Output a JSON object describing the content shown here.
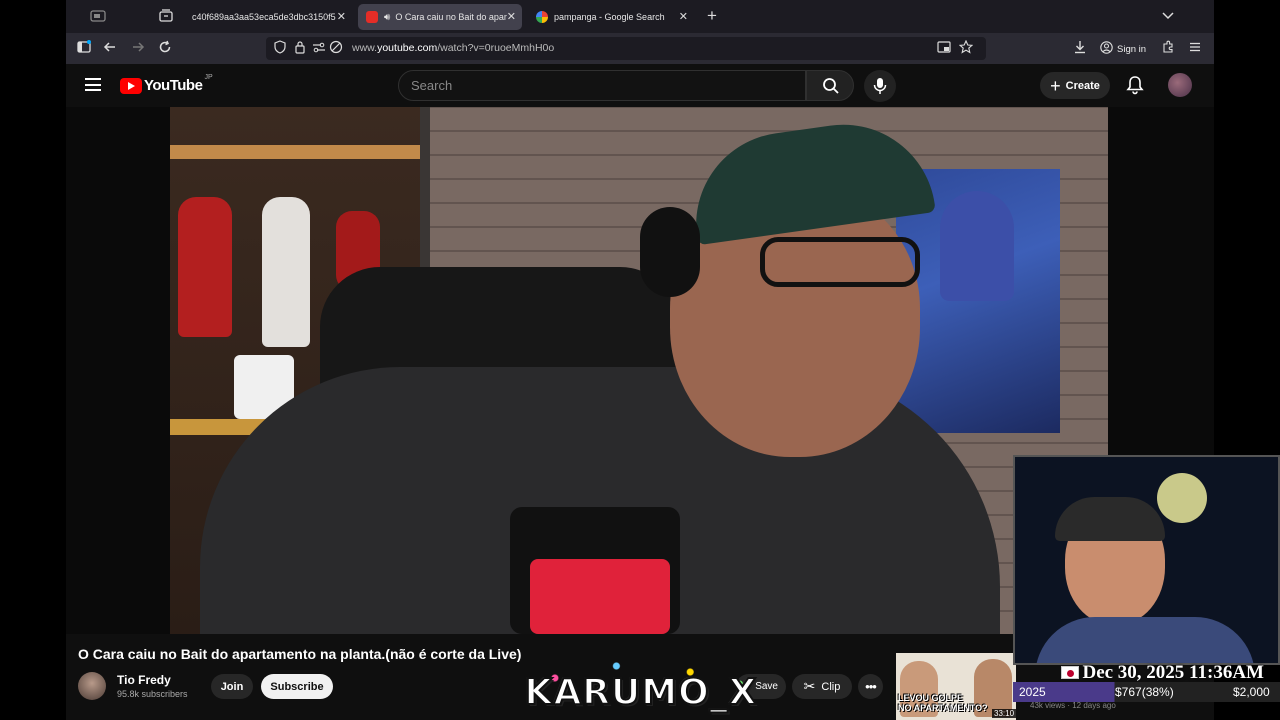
{
  "browser": {
    "tabs": [
      {
        "label": "c40f689aa3aa53eca5de3dbc3150f5",
        "active": false
      },
      {
        "label": "O Cara caiu no Bait do apar",
        "active": true
      },
      {
        "label": "pampanga - Google Search",
        "active": false
      }
    ],
    "url_prefix": "www.",
    "url_domain": "youtube.com",
    "url_path": "/watch?v=0ruoeMmhH0o",
    "sign_in_label": "Sign in"
  },
  "youtube": {
    "logo_text": "YouTube",
    "country_code": "JP",
    "search_placeholder": "Search",
    "create_label": "Create"
  },
  "video": {
    "title": "O Cara caiu no Bait do apartamento na planta.(não é corte da Live)",
    "channel_name": "Tio Fredy",
    "subscribers": "95.8k subscribers",
    "join_label": "Join",
    "subscribe_label": "Subscribe",
    "save_label": "Save",
    "clip_label": "Clip",
    "more_label": "•••"
  },
  "recommended": {
    "thumb_text": "LEVOU GOLPE\nNO APARTAMENTO?",
    "duration": "33:10",
    "meta": "43k views · 12 days ago"
  },
  "overlay": {
    "banner_text": "KARUMO_X",
    "datetime": "Dec 30, 2025 11:36AM",
    "year": "2025",
    "progress_text": "$767(38%)",
    "goal": "$2,000",
    "progress_fraction": 0.38
  },
  "colors": {
    "youtube_red": "#ff0000",
    "page_bg": "#0f0f0f",
    "accent_progress": "#4a3a8a"
  }
}
